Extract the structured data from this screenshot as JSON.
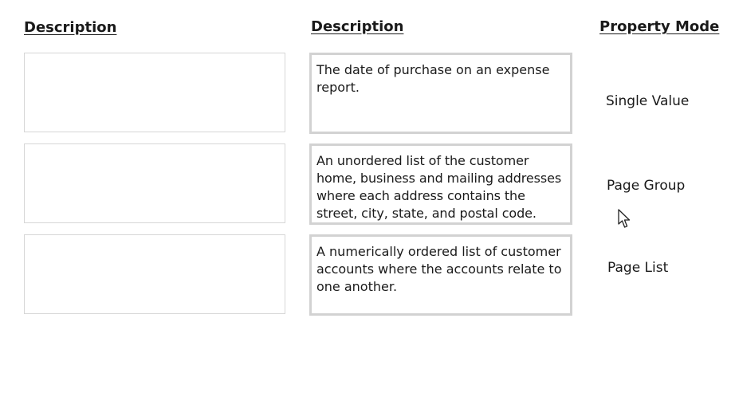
{
  "headers": {
    "left": "Description",
    "middle": "Description",
    "right": "Property Mode"
  },
  "drop_targets": [
    {
      "value": ""
    },
    {
      "value": ""
    },
    {
      "value": ""
    }
  ],
  "descriptions": [
    {
      "text": "The date of purchase on an expense report."
    },
    {
      "text": "An unordered list of the customer home, business and mailing addresses where each address contains the street, city, state, and postal code."
    },
    {
      "text": "A numerically ordered list of customer accounts where the accounts relate to one another."
    }
  ],
  "property_modes": [
    {
      "label": "Single Value"
    },
    {
      "label": "Page Group"
    },
    {
      "label": "Page List"
    }
  ],
  "cursor": {
    "icon": "mouse-pointer-icon"
  }
}
